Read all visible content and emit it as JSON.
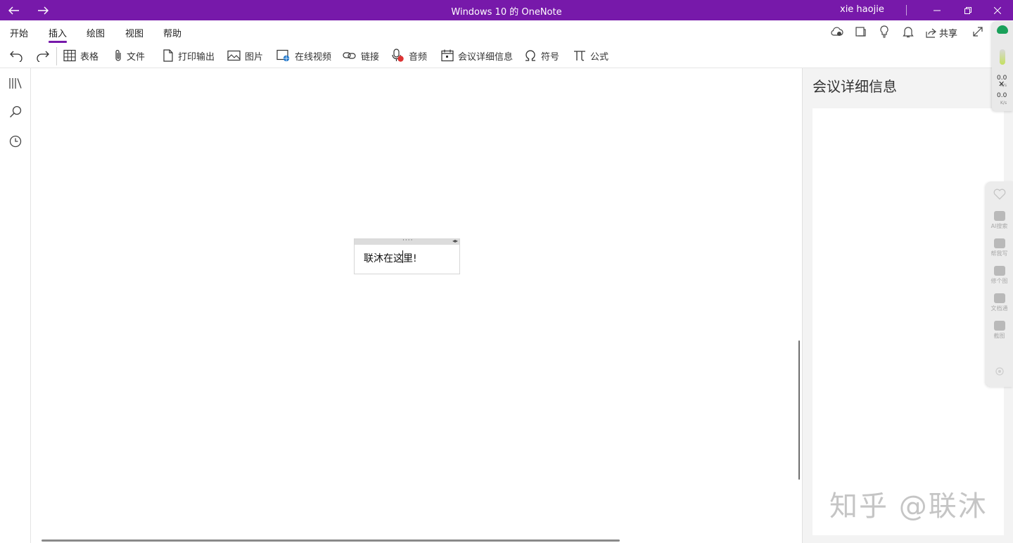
{
  "window": {
    "title": "Windows 10 的 OneNote",
    "user": "xie haojie",
    "back_icon": "arrow-left-icon",
    "forward_icon": "arrow-right-icon",
    "accent": "#7719aa"
  },
  "menubar": {
    "tabs": [
      {
        "label": "开始"
      },
      {
        "label": "插入",
        "active": true
      },
      {
        "label": "绘图"
      },
      {
        "label": "视图"
      },
      {
        "label": "帮助"
      }
    ],
    "share_label": "共享"
  },
  "ribbon": {
    "items": [
      {
        "label": "表格",
        "icon": "table-icon"
      },
      {
        "label": "文件",
        "icon": "paperclip-icon"
      },
      {
        "label": "打印输出",
        "icon": "document-icon"
      },
      {
        "label": "图片",
        "icon": "picture-icon"
      },
      {
        "label": "在线视频",
        "icon": "online-video-icon"
      },
      {
        "label": "链接",
        "icon": "link-icon"
      },
      {
        "label": "音频",
        "icon": "audio-icon"
      },
      {
        "label": "会议详细信息",
        "icon": "calendar-icon"
      },
      {
        "label": "符号",
        "icon": "omega-icon"
      },
      {
        "label": "公式",
        "icon": "pi-icon"
      }
    ]
  },
  "note": {
    "text": "联沐在这里!"
  },
  "right_pane": {
    "title": "会议详细信息"
  },
  "watermark": "知乎 @联沐",
  "speed_widget": {
    "upload": "0.0",
    "download": "0.0",
    "unit": "K/s"
  },
  "side_dock": {
    "items": [
      {
        "label": "AI搜索"
      },
      {
        "label": "帮我写"
      },
      {
        "label": "修个图"
      },
      {
        "label": "文档通"
      },
      {
        "label": "截图"
      }
    ]
  }
}
